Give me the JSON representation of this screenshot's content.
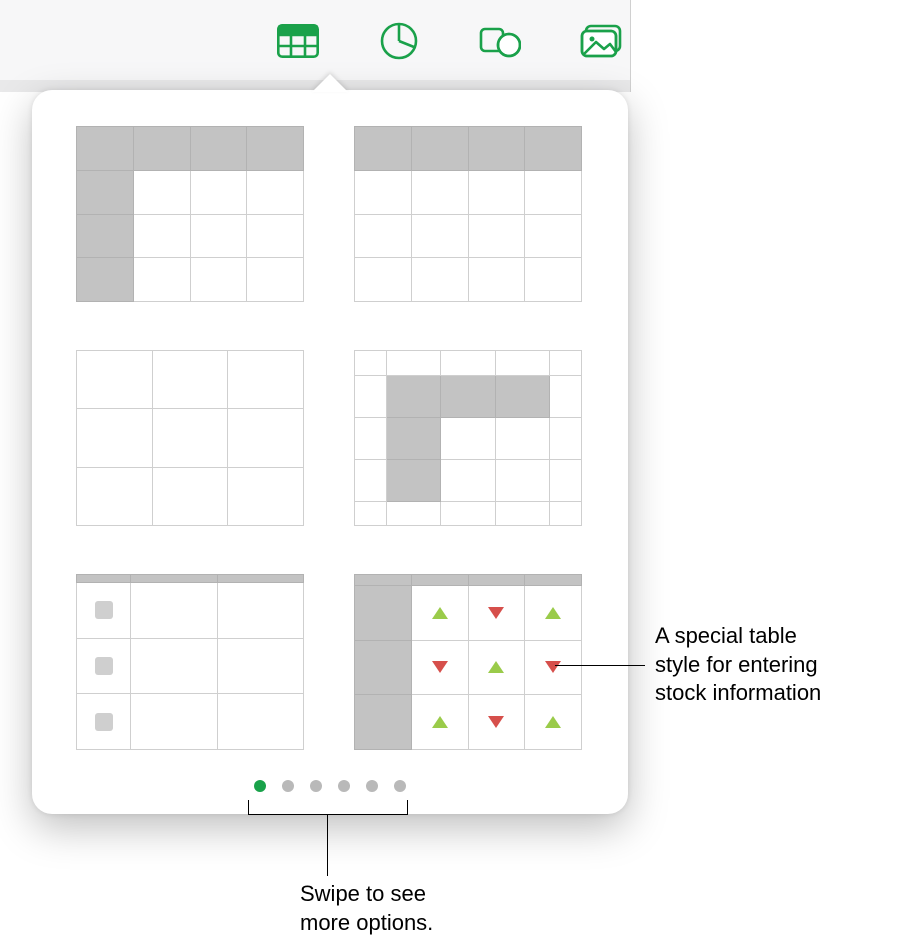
{
  "toolbar": {
    "icons": [
      "table-icon",
      "chart-icon",
      "shape-icon",
      "media-icon"
    ],
    "active_index": 0,
    "accent_color": "#1aa14a"
  },
  "popover": {
    "styles": [
      {
        "id": "header-row-and-column",
        "name": "Table with header row and header column"
      },
      {
        "id": "header-row",
        "name": "Table with header row"
      },
      {
        "id": "plain",
        "name": "Plain table"
      },
      {
        "id": "header-inset",
        "name": "Table with inset header row and column"
      },
      {
        "id": "checklist",
        "name": "Checklist table"
      },
      {
        "id": "stock",
        "name": "Stock table"
      }
    ],
    "page_count": 6,
    "active_page": 0
  },
  "callouts": {
    "stock_label_line1": "A special table",
    "stock_label_line2": "style for entering",
    "stock_label_line3": "stock information",
    "swipe_line1": "Swipe to see",
    "swipe_line2": "more options."
  }
}
